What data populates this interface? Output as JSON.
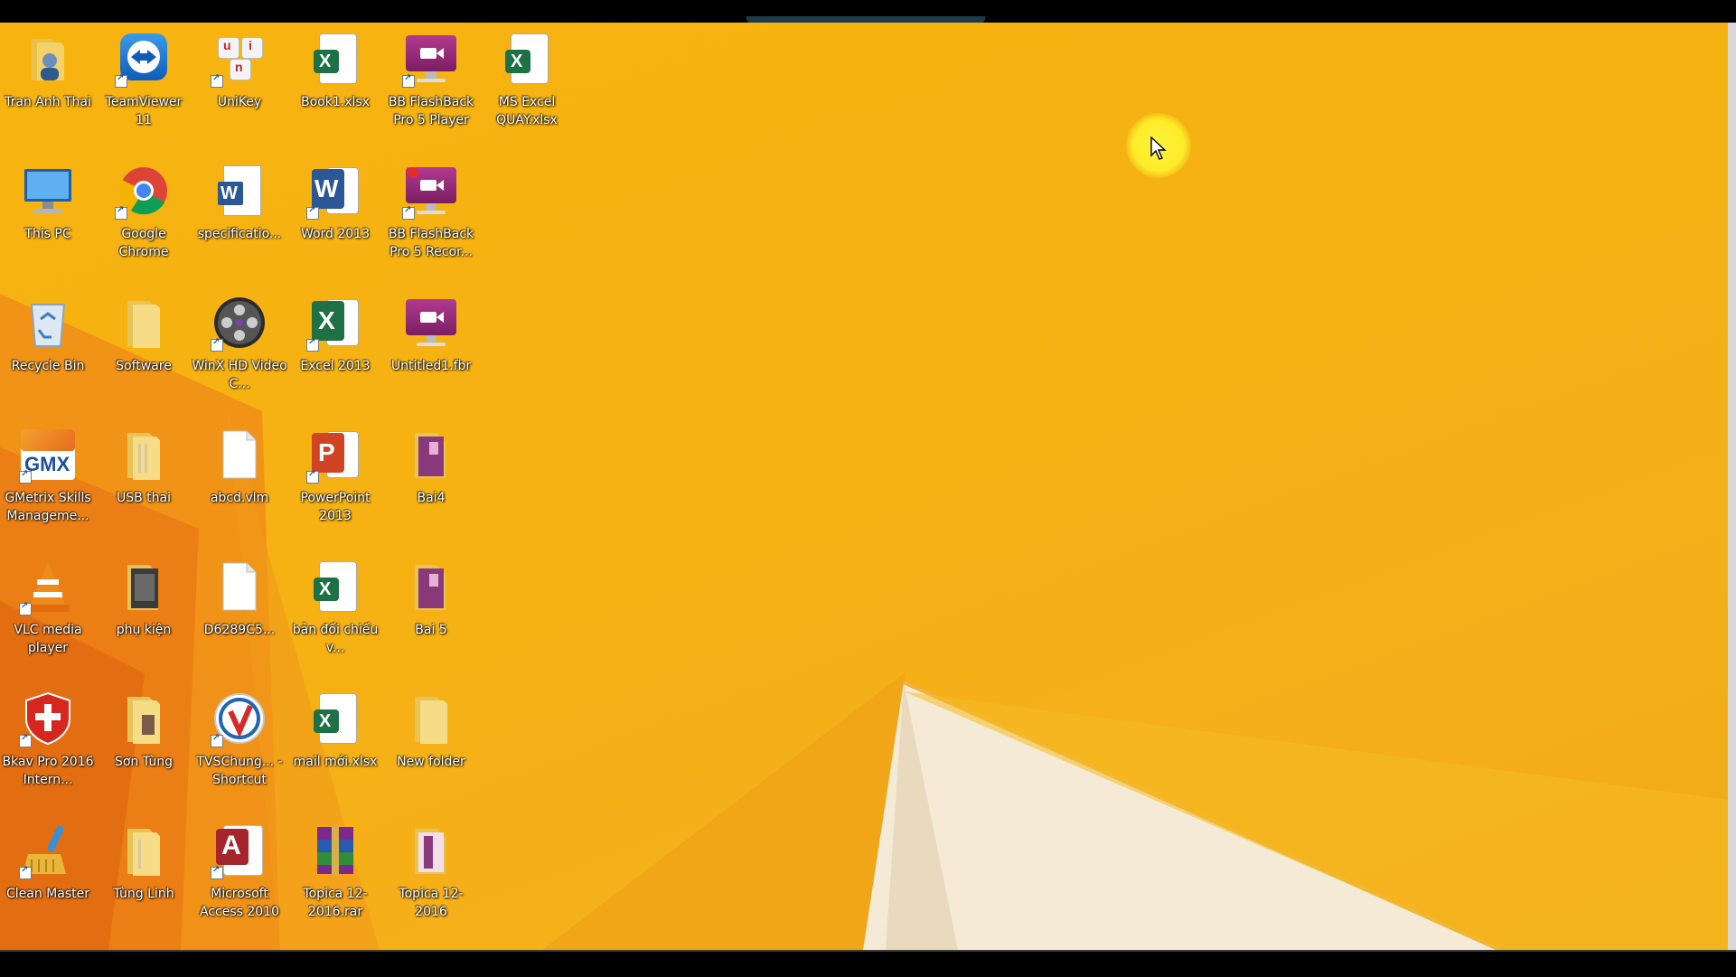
{
  "screen": {
    "accent_color": "#f5b010",
    "cursor": "arrow-cursor"
  },
  "desktop": {
    "icons": [
      {
        "label": "Tran Anh Thai",
        "icon": "user-folder-icon"
      },
      {
        "label": "TeamViewer 11",
        "icon": "teamviewer-icon"
      },
      {
        "label": "UniKey",
        "icon": "unikey-icon"
      },
      {
        "label": "Book1.xlsx",
        "icon": "excel-file-icon"
      },
      {
        "label": "BB FlashBack Pro 5 Player",
        "icon": "flashback-player-icon"
      },
      {
        "label": "MS Excel QUAY.xlsx",
        "icon": "excel-file-icon"
      },
      {
        "label": "This PC",
        "icon": "this-pc-icon"
      },
      {
        "label": "Google Chrome",
        "icon": "chrome-icon"
      },
      {
        "label": "specificatio...",
        "icon": "word-file-icon"
      },
      {
        "label": "Word 2013",
        "icon": "word-icon"
      },
      {
        "label": "BB FlashBack Pro 5 Recor...",
        "icon": "flashback-recorder-icon"
      },
      {
        "label": "Recycle Bin",
        "icon": "recycle-bin-icon"
      },
      {
        "label": "Software",
        "icon": "folder-icon"
      },
      {
        "label": "WinX HD Video C...",
        "icon": "winx-video-icon"
      },
      {
        "label": "Excel 2013",
        "icon": "excel-icon"
      },
      {
        "label": "Untitled1.fbr",
        "icon": "flashback-file-icon"
      },
      {
        "label": "GMetrix Skills Manageme...",
        "icon": "gmetrix-icon"
      },
      {
        "label": "USB thai",
        "icon": "folder-icon"
      },
      {
        "label": "abcd.vlm",
        "icon": "blank-file-icon"
      },
      {
        "label": "PowerPoint 2013",
        "icon": "powerpoint-icon"
      },
      {
        "label": "Bai4",
        "icon": "folder-icon"
      },
      {
        "label": "VLC media player",
        "icon": "vlc-icon"
      },
      {
        "label": "phụ kiện",
        "icon": "folder-icon"
      },
      {
        "label": "D6289C5...",
        "icon": "blank-file-icon"
      },
      {
        "label": "bản đối chiếu v...",
        "icon": "excel-file-icon"
      },
      {
        "label": "Bai 5",
        "icon": "folder-icon"
      },
      {
        "label": "Bkav Pro 2016 Intern...",
        "icon": "bkav-icon"
      },
      {
        "label": "Sơn Tùng",
        "icon": "folder-icon"
      },
      {
        "label": "TVSChung... - Shortcut",
        "icon": "tvs-icon"
      },
      {
        "label": "mail mới.xlsx",
        "icon": "excel-file-icon"
      },
      {
        "label": "New folder",
        "icon": "folder-icon"
      },
      {
        "label": "Clean Master",
        "icon": "clean-master-icon"
      },
      {
        "label": "Tùng Linh",
        "icon": "folder-icon"
      },
      {
        "label": "Microsoft Access 2010",
        "icon": "access-icon"
      },
      {
        "label": "Topica 12-2016.rar",
        "icon": "winrar-icon"
      },
      {
        "label": "Topica 12-2016",
        "icon": "folder-icon"
      }
    ]
  }
}
